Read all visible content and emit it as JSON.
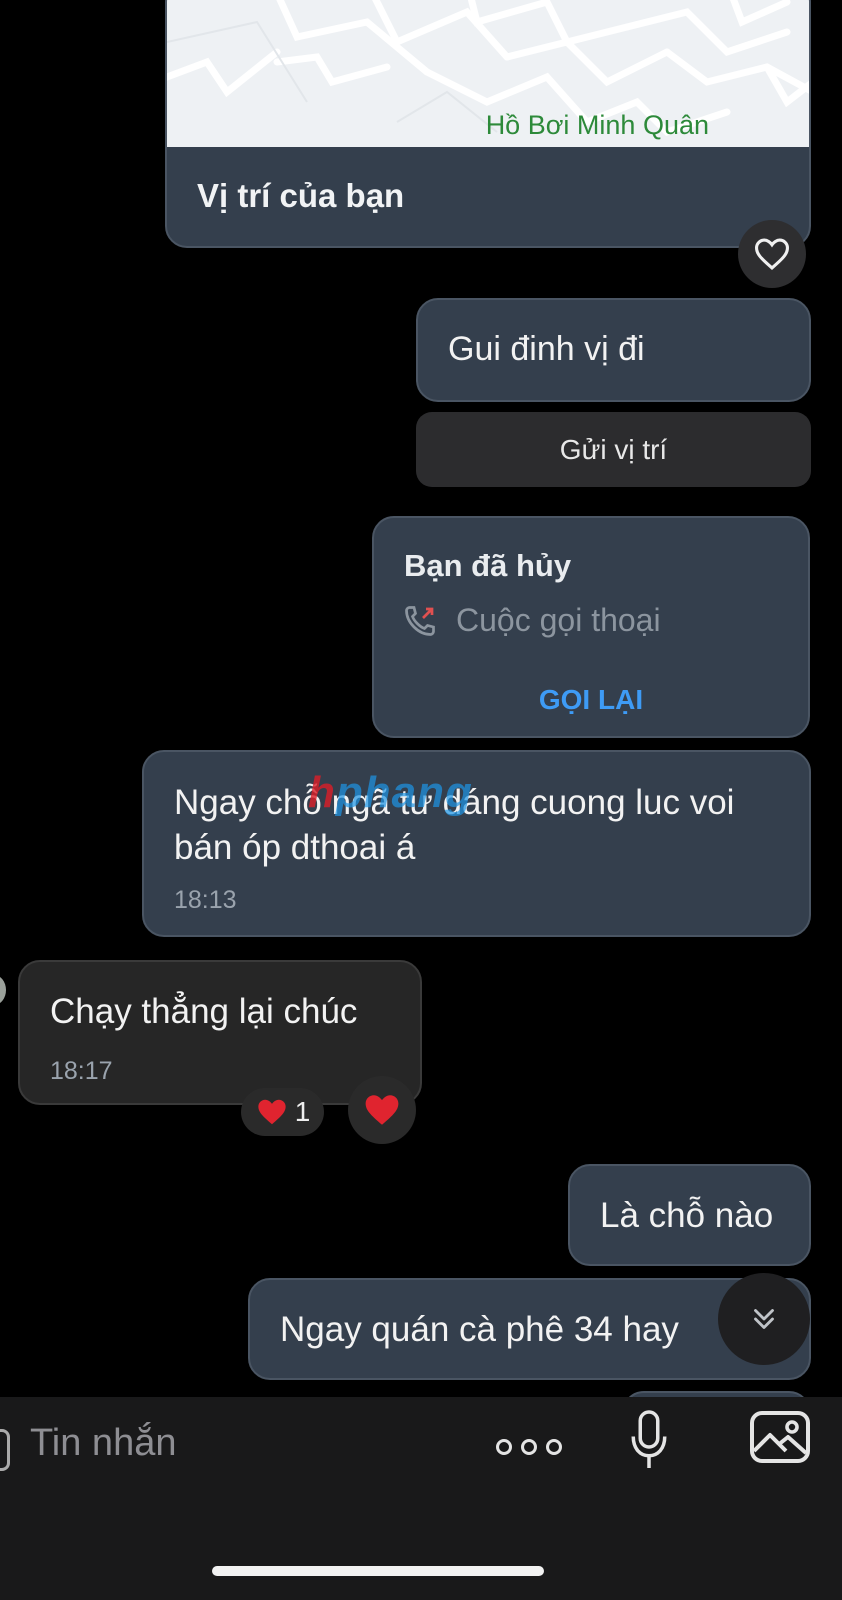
{
  "map_card": {
    "place_label": "Hồ Bơi Minh Quân",
    "caption": "Vị trí của bạn"
  },
  "messages": [
    {
      "id": "m1",
      "direction": "outgoing",
      "text": "Gui đinh vị đi"
    },
    {
      "id": "m3",
      "direction": "outgoing",
      "text": "Ngay chỗ ngã tư dáng cuong luc voi bán óp dthoai á",
      "time": "18:13"
    },
    {
      "id": "m4",
      "direction": "incoming",
      "text": "Chạy thẳng lại chúc",
      "time": "18:17"
    },
    {
      "id": "m5",
      "direction": "outgoing",
      "text": "Là chỗ nào"
    },
    {
      "id": "m6",
      "direction": "outgoing",
      "text": "Ngay quán cà phê 34 hay"
    }
  ],
  "send_location_button": "Gửi vị trí",
  "call_card": {
    "title": "Bạn đã hủy",
    "call_type": "Cuộc gọi thoại",
    "action": "GỌI LẠI"
  },
  "reaction": {
    "emoji": "❤️",
    "count": "1"
  },
  "watermark": {
    "prefix": "h",
    "rest": "phang"
  },
  "composer": {
    "placeholder": "Tin nhắn"
  },
  "colors": {
    "bubble_outgoing": "#343f4d",
    "bubble_incoming": "#262626",
    "accent_blue": "#3e9bf5",
    "heart_red": "#e0242f",
    "map_label_green": "#2d8a3a"
  },
  "icons": [
    "heart-outline-icon",
    "phone-missed-icon",
    "heart-filled-icon",
    "chevrons-down-icon",
    "more-dots-icon",
    "microphone-icon",
    "image-icon"
  ]
}
